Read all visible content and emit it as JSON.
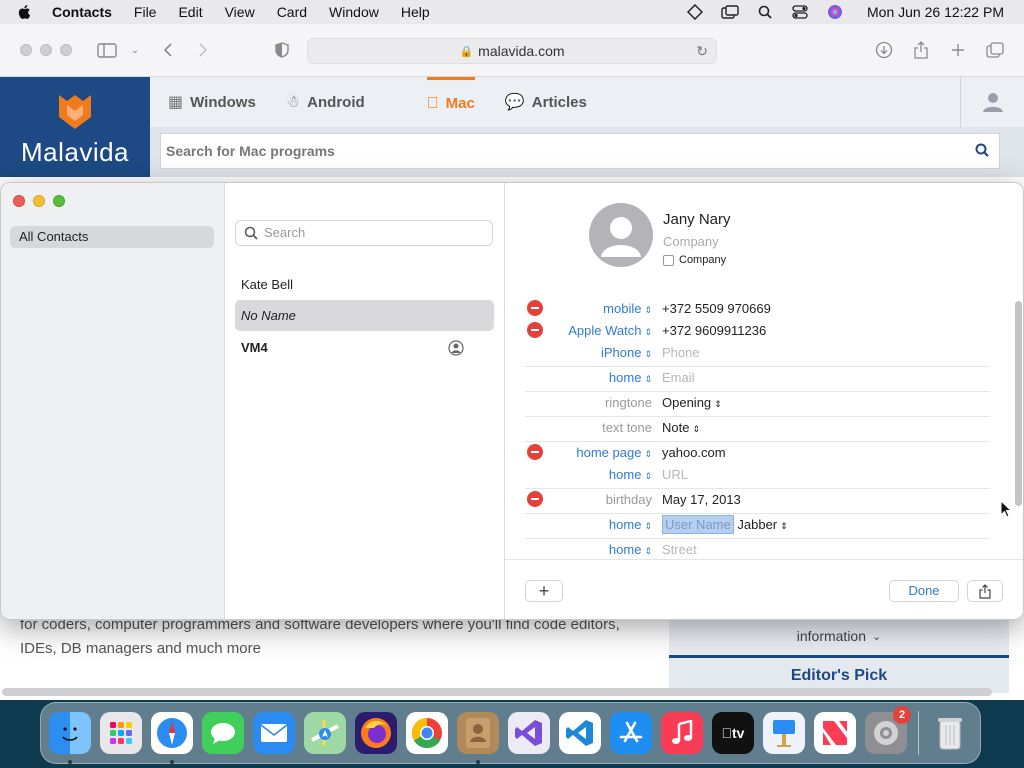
{
  "menubar": {
    "app_name": "Contacts",
    "items": [
      "File",
      "Edit",
      "View",
      "Card",
      "Window",
      "Help"
    ],
    "clock": "Mon Jun 26  12:22 PM"
  },
  "safari": {
    "url": "malavida.com"
  },
  "malavida": {
    "brand": "Malavida",
    "nav": [
      "Windows",
      "Android",
      "Mac",
      "Articles"
    ],
    "active_nav": "Mac",
    "search_placeholder": "Search for Mac programs",
    "body_text": "for coders, computer programmers and software developers where you'll find code editors, IDEs, DB managers and much more",
    "side_label": "information",
    "editors_pick": "Editor's Pick",
    "accent": "#f07b1d",
    "brand_color": "#1d4a84"
  },
  "contacts": {
    "sidebar": {
      "all_contacts": "All Contacts"
    },
    "list": {
      "search_placeholder": "Search",
      "rows": [
        "Kate Bell",
        "No Name",
        "VM4"
      ]
    },
    "card": {
      "name": "Jany  Nary",
      "company_placeholder": "Company",
      "company_checkbox": "Company",
      "fields": [
        {
          "label": "mobile",
          "value": "+372 5509 970669"
        },
        {
          "label": "Apple Watch",
          "value": "+372 9609911236"
        },
        {
          "label": "iPhone",
          "value": "Phone"
        },
        {
          "label": "home",
          "value": "Email"
        },
        {
          "label": "ringtone",
          "value": "Opening"
        },
        {
          "label": "text tone",
          "value": "Note"
        },
        {
          "label": "home page",
          "value": "yahoo.com"
        },
        {
          "label": "home",
          "value": "URL"
        },
        {
          "label": "birthday",
          "value": "May 17, 2013"
        },
        {
          "label": "home",
          "value": "User Name",
          "service": "Jabber"
        },
        {
          "label": "home",
          "value": "Street"
        }
      ],
      "plus_label": "+",
      "done_label": "Done"
    }
  },
  "dock": {
    "apps": [
      "Finder",
      "Launchpad",
      "Safari",
      "Messages",
      "Mail",
      "Maps",
      "Firefox",
      "Chrome",
      "Contacts",
      "Visual Studio",
      "VS Code",
      "App Store",
      "Music",
      "TV",
      "Keynote",
      "News",
      "System Preferences",
      "Trash"
    ],
    "settings_badge": "2",
    "tv_label": "tv"
  }
}
